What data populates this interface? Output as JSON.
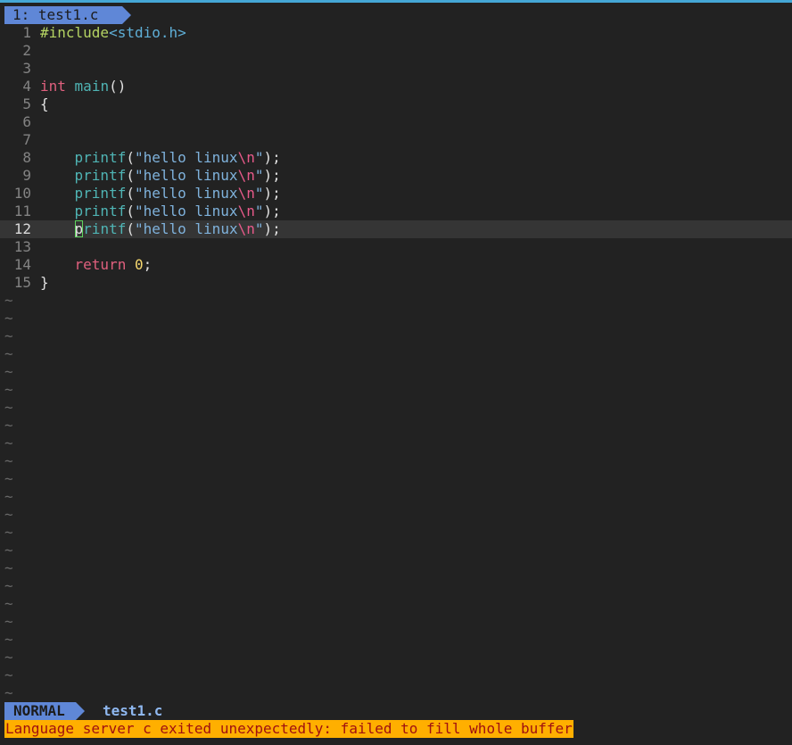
{
  "tabline": {
    "tab_label": "1: test1.c"
  },
  "editor": {
    "lines": [
      {
        "num": "1",
        "tokens": [
          [
            "c-pre",
            "#include"
          ],
          [
            "c-inc",
            "<stdio.h>"
          ]
        ]
      },
      {
        "num": "2",
        "tokens": []
      },
      {
        "num": "3",
        "tokens": []
      },
      {
        "num": "4",
        "tokens": [
          [
            "c-kw",
            "int"
          ],
          [
            "c-plain",
            " "
          ],
          [
            "c-fn",
            "main"
          ],
          [
            "c-plain",
            "()"
          ]
        ]
      },
      {
        "num": "5",
        "tokens": [
          [
            "c-plain",
            "{"
          ]
        ]
      },
      {
        "num": "6",
        "tokens": []
      },
      {
        "num": "7",
        "tokens": []
      },
      {
        "num": "8",
        "tokens": [
          [
            "c-plain",
            "    "
          ],
          [
            "c-fn",
            "printf"
          ],
          [
            "c-plain",
            "("
          ],
          [
            "c-str",
            "\"hello linux"
          ],
          [
            "c-esc",
            "\\n"
          ],
          [
            "c-str",
            "\""
          ],
          [
            "c-plain",
            ");"
          ]
        ]
      },
      {
        "num": "9",
        "tokens": [
          [
            "c-plain",
            "    "
          ],
          [
            "c-fn",
            "printf"
          ],
          [
            "c-plain",
            "("
          ],
          [
            "c-str",
            "\"hello linux"
          ],
          [
            "c-esc",
            "\\n"
          ],
          [
            "c-str",
            "\""
          ],
          [
            "c-plain",
            ");"
          ]
        ]
      },
      {
        "num": "10",
        "tokens": [
          [
            "c-plain",
            "    "
          ],
          [
            "c-fn",
            "printf"
          ],
          [
            "c-plain",
            "("
          ],
          [
            "c-str",
            "\"hello linux"
          ],
          [
            "c-esc",
            "\\n"
          ],
          [
            "c-str",
            "\""
          ],
          [
            "c-plain",
            ");"
          ]
        ]
      },
      {
        "num": "11",
        "tokens": [
          [
            "c-plain",
            "    "
          ],
          [
            "c-fn",
            "printf"
          ],
          [
            "c-plain",
            "("
          ],
          [
            "c-str",
            "\"hello linux"
          ],
          [
            "c-esc",
            "\\n"
          ],
          [
            "c-str",
            "\""
          ],
          [
            "c-plain",
            ");"
          ]
        ]
      },
      {
        "num": "12",
        "current": true,
        "tokens": [
          [
            "c-plain",
            "    "
          ],
          [
            "cursor",
            "p"
          ],
          [
            "c-fn",
            "rintf"
          ],
          [
            "c-plain",
            "("
          ],
          [
            "c-str",
            "\"hello linux"
          ],
          [
            "c-esc",
            "\\n"
          ],
          [
            "c-str",
            "\""
          ],
          [
            "c-plain",
            ");"
          ]
        ]
      },
      {
        "num": "13",
        "tokens": []
      },
      {
        "num": "14",
        "tokens": [
          [
            "c-plain",
            "    "
          ],
          [
            "c-kw",
            "return"
          ],
          [
            "c-plain",
            " "
          ],
          [
            "c-num",
            "0"
          ],
          [
            "c-plain",
            ";"
          ]
        ]
      },
      {
        "num": "15",
        "tokens": [
          [
            "c-plain",
            "}"
          ]
        ]
      }
    ],
    "tilde_char": "~",
    "tilde_count": 23
  },
  "statusline": {
    "mode": "NORMAL",
    "filename": "test1.c"
  },
  "message": {
    "text": "Language server c exited unexpectedly: failed to fill whole buffer"
  },
  "colors": {
    "background": "#222222",
    "accent": "#5f87d7",
    "error_bg": "#ffaf00",
    "error_fg": "#a01010"
  }
}
